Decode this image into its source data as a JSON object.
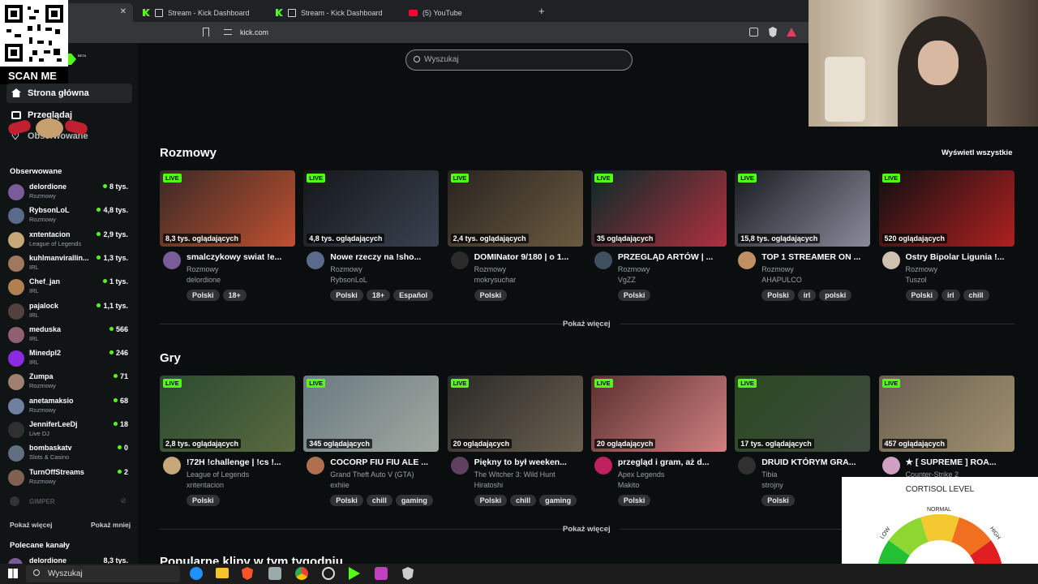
{
  "browser": {
    "tabs": [
      {
        "label": "",
        "active": true
      },
      {
        "label": "Stream - Kick Dashboard"
      },
      {
        "label": "Stream - Kick Dashboard"
      },
      {
        "label": "(5) YouTube"
      }
    ],
    "url": "kick.com"
  },
  "overlay": {
    "scan_label": "SCAN ME",
    "beta": "BETA"
  },
  "search": {
    "placeholder": "Wyszukaj"
  },
  "sidebar": {
    "nav": [
      {
        "label": "Strona główna",
        "icon": "home-icon"
      },
      {
        "label": "Przeglądaj",
        "icon": "browse-icon"
      },
      {
        "label": "Obserwowane",
        "icon": "heart-icon"
      }
    ],
    "followed_title": "Obserwowane",
    "channels": [
      {
        "name": "delordione",
        "category": "Rozmowy",
        "viewers": "8 tys.",
        "color": "#7a5c9a"
      },
      {
        "name": "RybsonLoL",
        "category": "Rozmowy",
        "viewers": "4,8 tys.",
        "color": "#5a6a8a"
      },
      {
        "name": "xntentacion",
        "category": "League of Legends",
        "viewers": "2,9 tys.",
        "color": "#c8a878"
      },
      {
        "name": "kuhlmanvirallin...",
        "category": "IRL",
        "viewers": "1,3 tys.",
        "color": "#a07860"
      },
      {
        "name": "Chef_jan",
        "category": "IRL",
        "viewers": "1 tys.",
        "color": "#b08050"
      },
      {
        "name": "pajalock",
        "category": "IRL",
        "viewers": "1,1 tys.",
        "color": "#504040"
      },
      {
        "name": "meduska",
        "category": "IRL",
        "viewers": "566",
        "color": "#906070"
      },
      {
        "name": "Minedpl2",
        "category": "IRL",
        "viewers": "246",
        "color": "#8a2be2"
      },
      {
        "name": "Zumpa",
        "category": "Rozmowy",
        "viewers": "71",
        "color": "#a08070"
      },
      {
        "name": "anetamaksio",
        "category": "Rozmowy",
        "viewers": "68",
        "color": "#7080a0"
      },
      {
        "name": "JenniferLeeDj",
        "category": "Live DJ",
        "viewers": "18",
        "color": "#303030"
      },
      {
        "name": "bombaskatv",
        "category": "Slots & Casino",
        "viewers": "0",
        "color": "#607080"
      },
      {
        "name": "TurnOffStreams",
        "category": "Rozmowy",
        "viewers": "2",
        "color": "#806050"
      }
    ],
    "dim_channel": "GIMPER",
    "show_more": "Pokaż więcej",
    "show_less": "Pokaż mniej",
    "recommended_title": "Polecane kanały",
    "recommended_first": {
      "name": "delordione",
      "viewers": "8,3 tys."
    }
  },
  "sections": [
    {
      "title": "Rozmowy",
      "show_all": "Wyświetl wszystkie",
      "more": "Pokaż więcej",
      "cards": [
        {
          "viewers": "8,3 tys. oglądających",
          "title": "smalczykowy swiat !e...",
          "category": "Rozmowy",
          "channel": "delordione",
          "tags": [
            "Polski",
            "18+"
          ],
          "thumb": [
            "#3a2a25",
            "#c05030"
          ],
          "avatar": "#7a5c9a"
        },
        {
          "viewers": "4,8 tys. oglądających",
          "title": "Nowe rzeczy na !sho...",
          "category": "Rozmowy",
          "channel": "RybsonLoL",
          "tags": [
            "Polski",
            "18+",
            "Español"
          ],
          "thumb": [
            "#15171a",
            "#3a4250"
          ],
          "avatar": "#5a6a8a"
        },
        {
          "viewers": "2,4 tys. oglądających",
          "title": "DOMINator 9/180 | o 1...",
          "category": "Rozmowy",
          "channel": "mokrysuchar",
          "tags": [
            "Polski"
          ],
          "thumb": [
            "#2a2420",
            "#6a5a40"
          ],
          "avatar": "#2a2a2a"
        },
        {
          "viewers": "35 oglądających",
          "title": "PRZEGLĄD ARTÓW | ...",
          "category": "Rozmowy",
          "channel": "VgZZ",
          "tags": [
            "Polski"
          ],
          "thumb": [
            "#0a2a28",
            "#b03040"
          ],
          "avatar": "#405060"
        },
        {
          "viewers": "15,8 tys. oglądających",
          "title": "TOP 1 STREAMER ON ...",
          "category": "Rozmowy",
          "channel": "AHAPULCO",
          "tags": [
            "Polski",
            "irl",
            "polski"
          ],
          "thumb": [
            "#1a1c22",
            "#8a8a9a"
          ],
          "avatar": "#c09060"
        },
        {
          "viewers": "520 oglądających",
          "title": "Ostry Bipolar Ligunia !...",
          "category": "Rozmowy",
          "channel": "Tuszol",
          "tags": [
            "Polski",
            "irl",
            "chill"
          ],
          "thumb": [
            "#101012",
            "#b02020"
          ],
          "avatar": "#d0c0b0"
        }
      ]
    },
    {
      "title": "Gry",
      "more": "Pokaż więcej",
      "cards": [
        {
          "viewers": "2,8 tys. oglądających",
          "title": "!72H !challenge | !cs !...",
          "category": "League of Legends",
          "channel": "xntentacion",
          "tags": [
            "Polski"
          ],
          "thumb": [
            "#2a4a30",
            "#5a6a40"
          ],
          "avatar": "#c8a878"
        },
        {
          "viewers": "345 oglądających",
          "title": "COCORP FIU FIU ALE ...",
          "category": "Grand Theft Auto V (GTA)",
          "channel": "exhiie",
          "tags": [
            "Polski",
            "chill",
            "gaming"
          ],
          "thumb": [
            "#6a7a80",
            "#a0a8a0"
          ],
          "avatar": "#b07050"
        },
        {
          "viewers": "20 oglądających",
          "title": "Piękny to był weeken...",
          "category": "The Witcher 3: Wild Hunt",
          "channel": "Hiratoshi",
          "tags": [
            "Polski",
            "chill",
            "gaming"
          ],
          "thumb": [
            "#2a2a28",
            "#6a6050"
          ],
          "avatar": "#604060"
        },
        {
          "viewers": "20 oglądających",
          "title": "przegląd i gram, aż d...",
          "category": "Apex Legends",
          "channel": "Makito",
          "tags": [
            "Polski"
          ],
          "thumb": [
            "#5a3030",
            "#d08080"
          ],
          "avatar": "#c02060"
        },
        {
          "viewers": "17 tys. oglądających",
          "title": "DRUID KTÓRYM GRA...",
          "category": "Tibia",
          "channel": "strojny",
          "tags": [
            "Polski"
          ],
          "thumb": [
            "#2a4a20",
            "#404a40"
          ],
          "avatar": "#303030"
        },
        {
          "viewers": "457 oglądających",
          "title": "★ [ SUPREME ] ROA...",
          "category": "Counter-Strike 2",
          "channel": "",
          "tags": [],
          "thumb": [
            "#6a6050",
            "#a09070"
          ],
          "avatar": "#d0a0c0"
        }
      ]
    }
  ],
  "clips_title": "Popularne klipy w tym tygodniu",
  "taskbar": {
    "search": "Wyszukaj"
  },
  "cortisol": {
    "title": "CORTISOL LEVEL",
    "low": "LOW",
    "normal": "NORMAL",
    "high": "HIGH",
    "level": 0.08
  }
}
